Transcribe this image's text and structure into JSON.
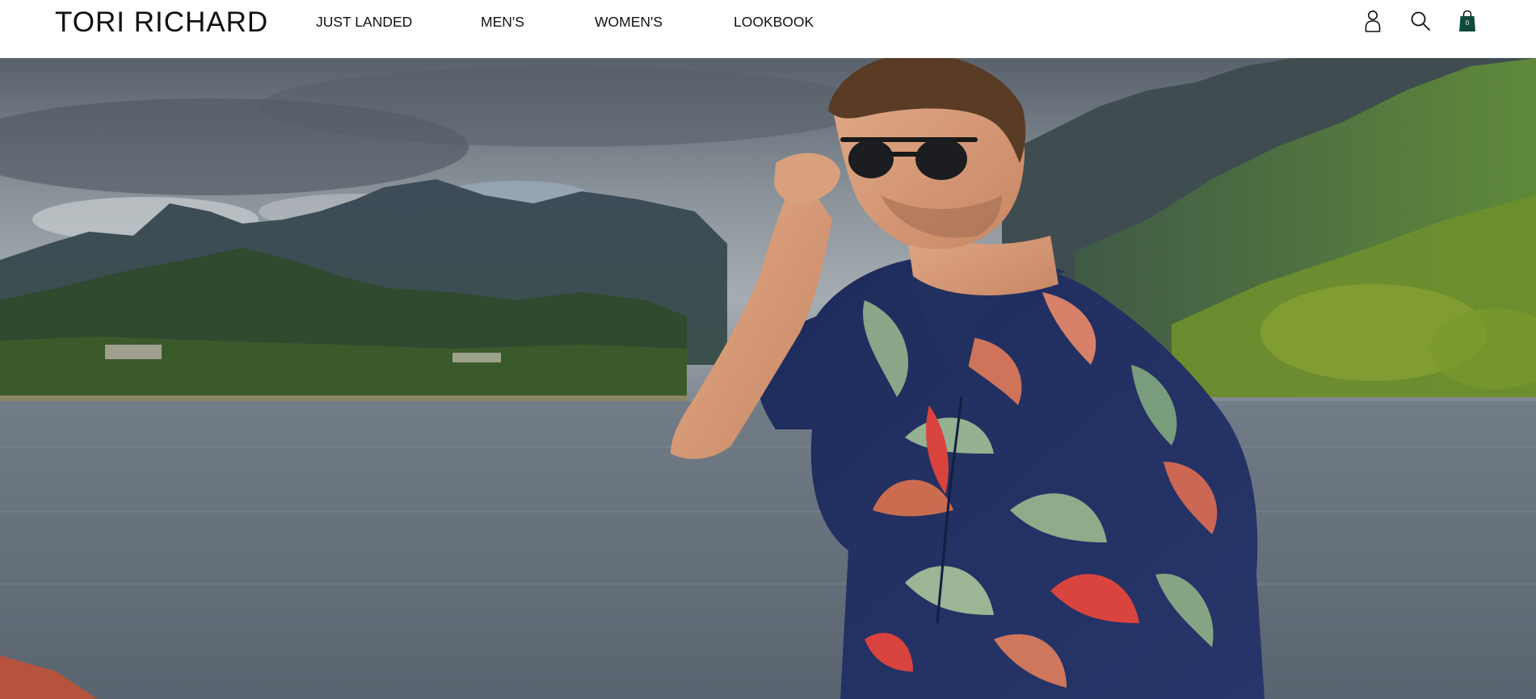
{
  "brand": {
    "name": "TORI RICHARD"
  },
  "nav": {
    "items": [
      {
        "label": "JUST LANDED"
      },
      {
        "label": "MEN'S"
      },
      {
        "label": "WOMEN'S"
      },
      {
        "label": "LOOKBOOK"
      }
    ]
  },
  "header_icons": {
    "account": "account-icon",
    "search": "search-icon",
    "cart": "shopping-bag-icon",
    "cart_count": "0"
  },
  "colors": {
    "text": "#111111",
    "cart_accent": "#0f4a3c",
    "header_bg": "#ffffff"
  },
  "hero": {
    "image": "hero-photo"
  }
}
